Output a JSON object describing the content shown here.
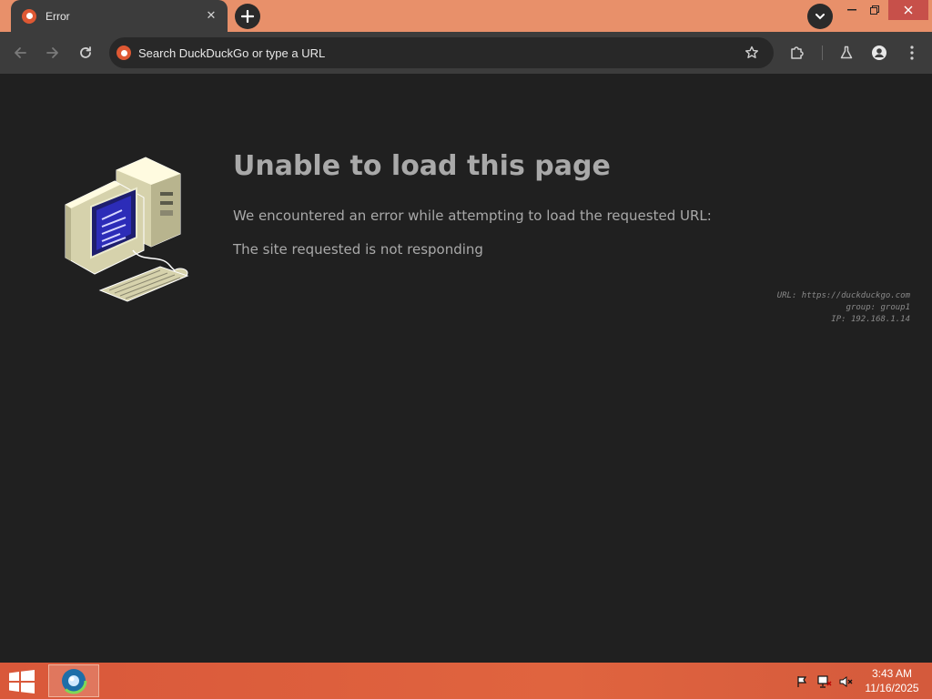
{
  "browser": {
    "tab": {
      "title": "Error",
      "favicon": "duckduckgo-icon"
    },
    "omnibox": {
      "placeholder": "Search DuckDuckGo or type a URL"
    },
    "accent_titlebar": "#e8906a",
    "toolbar_color": "#3c3c3c"
  },
  "page": {
    "title": "Unable to load this page",
    "description": "We encountered an error while attempting to load the requested URL:",
    "reason": "The site requested is not responding",
    "details": {
      "url": "URL: https://duckduckgo.com",
      "group": "group: group1",
      "ip": "IP: 192.168.1.14"
    },
    "background": "#202020",
    "text_color": "#a9a9a9"
  },
  "taskbar": {
    "time": "3:43 AM",
    "date": "11/16/2025",
    "color": "#d9583a"
  }
}
